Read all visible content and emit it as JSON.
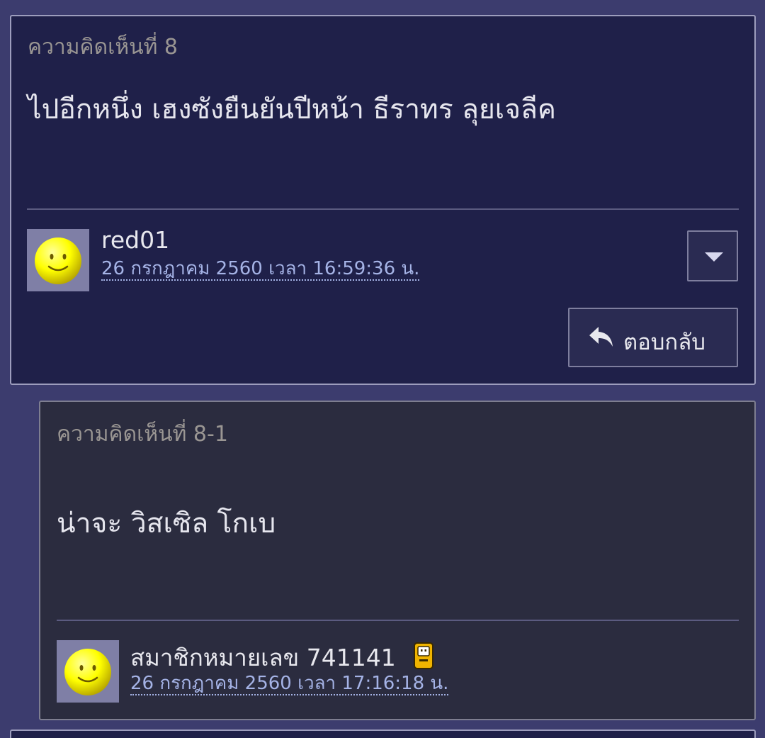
{
  "comment": {
    "number_label": "ความคิดเห็นที่ 8",
    "text": "ไปอีกหนึ่ง เฮงซังยืนยันปีหน้า ธีราทร ลุยเจลีค",
    "username": "red01",
    "timestamp": "26 กรกฎาคม 2560 เวลา 16:59:36 น.",
    "avatar_icon": "smiley-avatar-icon",
    "menu_icon": "chevron-down-icon",
    "reply_label": "ตอบกลับ",
    "reply_icon": "reply-arrow-icon"
  },
  "reply": {
    "number_label": "ความคิดเห็นที่ 8-1",
    "text": "น่าจะ วิสเซิล โกเบ",
    "username": "สมาชิกหมายเลข 741141",
    "timestamp": "26 กรกฎาคม 2560 เวลา 17:16:18 น.",
    "avatar_icon": "smiley-avatar-icon",
    "device_icon": "mobile-phone-icon"
  },
  "colors": {
    "page_background": "#3c3c6e",
    "main_card_background": "#1f2049",
    "reply_card_background": "#2b2c3f",
    "timestamp_link": "#a5b3e6",
    "muted_label": "#9a9693"
  }
}
